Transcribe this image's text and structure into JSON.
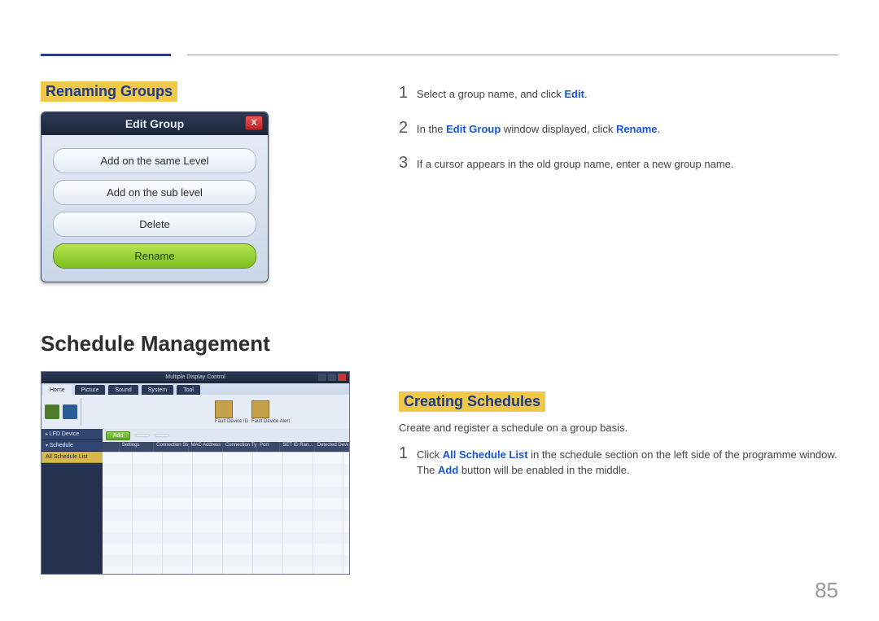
{
  "page_number": "85",
  "section1": {
    "title": "Renaming Groups",
    "steps": [
      {
        "num": "1",
        "pre": "Select a group name, and click ",
        "kw": "Edit",
        "post": "."
      },
      {
        "num": "2",
        "pre": "In the ",
        "kw": "Edit Group",
        "mid": " window displayed, click ",
        "kw2": "Rename",
        "post": "."
      },
      {
        "num": "3",
        "pre": "If a cursor appears in the old group name, enter a new group name.",
        "kw": "",
        "post": ""
      }
    ]
  },
  "dialog": {
    "title": "Edit Group",
    "close": "X",
    "buttons": [
      "Add on the same Level",
      "Add on the sub level",
      "Delete",
      "Rename"
    ]
  },
  "section2": {
    "heading": "Schedule Management",
    "title": "Creating Schedules",
    "intro": "Create and register a schedule on a group basis.",
    "steps": [
      {
        "num": "1",
        "pre": "Click ",
        "kw": "All Schedule List",
        "mid": " in the schedule section on the left side of the programme window. The ",
        "kw2": "Add",
        "post": " button will be enabled in the middle."
      }
    ]
  },
  "app": {
    "title": "Multiple Display Control",
    "tabs": [
      "Home",
      "Picture",
      "Sound",
      "System",
      "Tool"
    ],
    "fault1": "Fault Device ID",
    "fault2": "Fault Device Alert",
    "side": {
      "lfd": "LFD Device",
      "sched": "Schedule",
      "all": "All Schedule List"
    },
    "tool_add": "Add",
    "tool_b1": "",
    "tool_b2": "",
    "columns": [
      "",
      "Settings",
      "Connection Status",
      "MAC Address",
      "Connection Type",
      "Port",
      "SET ID Ran...",
      "Detected Devices"
    ]
  }
}
